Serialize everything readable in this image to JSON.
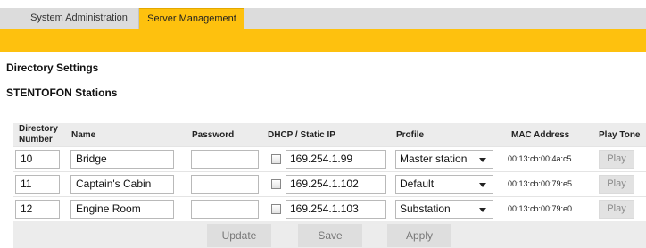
{
  "tabs": [
    {
      "label": "System Administration",
      "active": false
    },
    {
      "label": "Server Management",
      "active": true
    }
  ],
  "colors": {
    "accent": "#fec10e",
    "panel": "#ececec"
  },
  "section_title": "Directory Settings",
  "subsection_title": "STENTOFON Stations",
  "table": {
    "headers": {
      "directory_number_line1": "Directory",
      "directory_number_line2": "Number",
      "name": "Name",
      "password": "Password",
      "dhcp_static_ip": "DHCP / Static IP",
      "profile": "Profile",
      "mac_address": "MAC Address",
      "play_tone": "Play Tone"
    },
    "rows": [
      {
        "directory_number": "10",
        "name": "Bridge",
        "password": "",
        "dhcp_checked": false,
        "ip": "169.254.1.99",
        "profile": "Master station",
        "mac": "00:13:cb:00:4a:c5",
        "play_label": "Play"
      },
      {
        "directory_number": "11",
        "name": "Captain's Cabin",
        "password": "",
        "dhcp_checked": false,
        "ip": "169.254.1.102",
        "profile": "Default",
        "mac": "00:13:cb:00:79:e5",
        "play_label": "Play"
      },
      {
        "directory_number": "12",
        "name": "Engine Room",
        "password": "",
        "dhcp_checked": false,
        "ip": "169.254.1.103",
        "profile": "Substation",
        "mac": "00:13:cb:00:79:e0",
        "play_label": "Play"
      }
    ]
  },
  "buttons": {
    "update": "Update",
    "save": "Save",
    "apply": "Apply"
  }
}
